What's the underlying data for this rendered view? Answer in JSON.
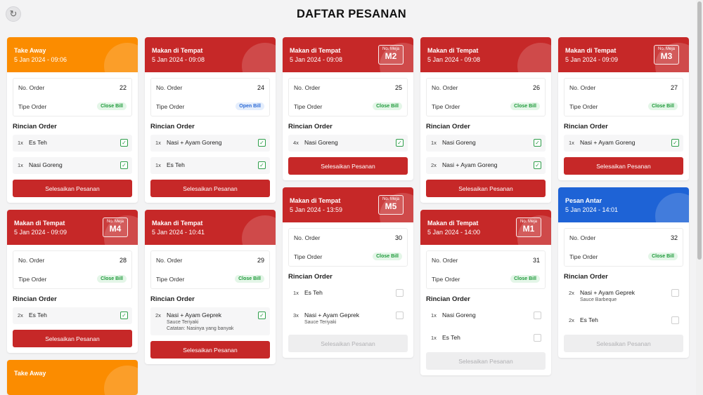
{
  "header": {
    "title": "DAFTAR PESANAN",
    "refresh_icon": "refresh-icon"
  },
  "labels": {
    "no_order": "No. Order",
    "tipe_order": "Tipe Order",
    "rincian_order": "Rincian Order",
    "no_meja": "No. Meja",
    "finish_button": "Selesaikan Pesanan"
  },
  "colors": {
    "red": "#c62828",
    "orange": "#fb8c00",
    "blue": "#1e63d6",
    "close_bill": "#1e9a3a",
    "open_bill": "#2b6ad6"
  },
  "columns": [
    [
      {
        "title": "Take Away",
        "time": "5 Jan 2024 - 09:06",
        "color": "orange",
        "table": "",
        "order_no": "22",
        "bill": "Close Bill",
        "items": [
          {
            "qty": "1x",
            "name": "Es Teh",
            "checked": true
          },
          {
            "qty": "1x",
            "name": "Nasi Goreng",
            "checked": true
          }
        ],
        "button_enabled": true
      },
      {
        "title": "Makan di Tempat",
        "time": "5 Jan 2024 - 09:09",
        "color": "red",
        "table": "M4",
        "order_no": "28",
        "bill": "Close Bill",
        "items": [
          {
            "qty": "2x",
            "name": "Es Teh",
            "checked": true
          }
        ],
        "button_enabled": true
      },
      {
        "title": "Take Away",
        "time": "",
        "color": "orange",
        "table": "",
        "order_no": "",
        "bill": "",
        "items": [],
        "button_enabled": true,
        "partial": true
      }
    ],
    [
      {
        "title": "Makan di Tempat",
        "time": "5 Jan 2024 - 09:08",
        "color": "red",
        "table": "",
        "order_no": "24",
        "bill": "Open Bill",
        "items": [
          {
            "qty": "1x",
            "name": "Nasi + Ayam Goreng",
            "checked": true
          },
          {
            "qty": "1x",
            "name": "Es Teh",
            "checked": true
          }
        ],
        "button_enabled": true
      },
      {
        "title": "Makan di Tempat",
        "time": "5 Jan 2024 - 10:41",
        "color": "red",
        "table": "",
        "order_no": "29",
        "bill": "Close Bill",
        "items": [
          {
            "qty": "2x",
            "name": "Nasi + Ayam Geprek",
            "sub": "Sauce Teriyaki",
            "note": "Catatan: Nasinya yang banyak",
            "checked": true
          }
        ],
        "button_enabled": true
      }
    ],
    [
      {
        "title": "Makan di Tempat",
        "time": "5 Jan 2024 - 09:08",
        "color": "red",
        "table": "M2",
        "order_no": "25",
        "bill": "Close Bill",
        "items": [
          {
            "qty": "4x",
            "name": "Nasi Goreng",
            "checked": true
          }
        ],
        "button_enabled": true
      },
      {
        "title": "Makan di Tempat",
        "time": "5 Jan 2024 - 13:59",
        "color": "red",
        "table": "M5",
        "order_no": "30",
        "bill": "Close Bill",
        "items": [
          {
            "qty": "1x",
            "name": "Es Teh",
            "checked": false
          },
          {
            "qty": "3x",
            "name": "Nasi + Ayam Geprek",
            "sub": "Sauce Teriyaki",
            "checked": false
          }
        ],
        "button_enabled": false
      }
    ],
    [
      {
        "title": "Makan di Tempat",
        "time": "5 Jan 2024 - 09:08",
        "color": "red",
        "table": "",
        "order_no": "26",
        "bill": "Close Bill",
        "items": [
          {
            "qty": "1x",
            "name": "Nasi Goreng",
            "checked": true
          },
          {
            "qty": "2x",
            "name": "Nasi + Ayam Goreng",
            "checked": true
          }
        ],
        "button_enabled": true
      },
      {
        "title": "Makan di Tempat",
        "time": "5 Jan 2024 - 14:00",
        "color": "red",
        "table": "M1",
        "order_no": "31",
        "bill": "Close Bill",
        "items": [
          {
            "qty": "1x",
            "name": "Nasi Goreng",
            "checked": false
          },
          {
            "qty": "1x",
            "name": "Es Teh",
            "checked": false
          }
        ],
        "button_enabled": false
      }
    ],
    [
      {
        "title": "Makan di Tempat",
        "time": "5 Jan 2024 - 09:09",
        "color": "red",
        "table": "M3",
        "order_no": "27",
        "bill": "Close Bill",
        "items": [
          {
            "qty": "1x",
            "name": "Nasi + Ayam Goreng",
            "checked": true
          }
        ],
        "button_enabled": true
      },
      {
        "title": "Pesan Antar",
        "time": "5 Jan 2024 - 14:01",
        "color": "blue",
        "table": "",
        "order_no": "32",
        "bill": "Close Bill",
        "items": [
          {
            "qty": "2x",
            "name": "Nasi + Ayam Geprek",
            "sub": "Sauce Barbeque",
            "checked": false
          },
          {
            "qty": "2x",
            "name": "Es Teh",
            "checked": false
          }
        ],
        "button_enabled": false
      }
    ]
  ]
}
